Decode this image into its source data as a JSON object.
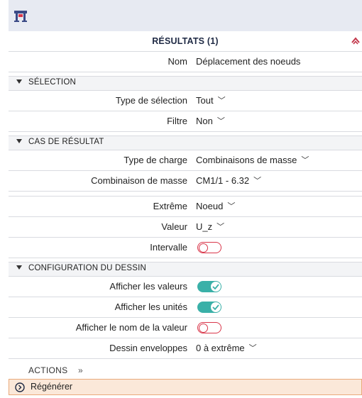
{
  "panel": {
    "title": "RÉSULTATS (1)",
    "name_label": "Nom",
    "name_value": "Déplacement des noeuds"
  },
  "sections": {
    "selection": {
      "header": "SÉLECTION",
      "type_label": "Type de sélection",
      "type_value": "Tout",
      "filter_label": "Filtre",
      "filter_value": "Non"
    },
    "result_case": {
      "header": "CAS DE RÉSULTAT",
      "load_type_label": "Type de charge",
      "load_type_value": "Combinaisons de masse",
      "mass_combo_label": "Combinaison de masse",
      "mass_combo_value": "CM1/1 - 6.32"
    },
    "extreme": {
      "extreme_label": "Extrême",
      "extreme_value": "Noeud",
      "value_label": "Valeur",
      "value_value": "U_z",
      "interval_label": "Intervalle",
      "interval_on": false
    },
    "drawing": {
      "header": "CONFIGURATION DU DESSIN",
      "show_values_label": "Afficher les valeurs",
      "show_values_on": true,
      "show_units_label": "Afficher les unités",
      "show_units_on": true,
      "show_value_name_label": "Afficher le nom de la valeur",
      "show_value_name_on": false,
      "envelope_label": "Dessin enveloppes",
      "envelope_value": "0 à extrême"
    }
  },
  "actions": {
    "label": "ACTIONS",
    "chevron": "»",
    "regenerate_label": "Régénérer"
  },
  "colors": {
    "toggle_on": "#3ab0a8",
    "toggle_off": "#d9364a",
    "regen_bg": "#fbe8d9"
  },
  "icons": {
    "app": "structure-table-icon",
    "collapse": "chevron-up-icon",
    "regenerate": "circle-chevron-right-icon"
  }
}
